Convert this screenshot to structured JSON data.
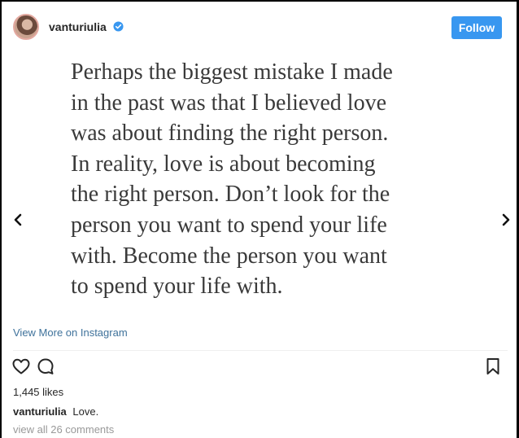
{
  "post": {
    "username": "vanturiulia",
    "verified": true,
    "follow_label": "Follow",
    "quote_lines": [
      "Perhaps the biggest mistake I made",
      "in the past was that I believed love",
      "was about finding the right person.",
      "In reality, love is about becoming",
      "the right person. Don’t look for the",
      "person you want to spend your life",
      "with. Become the person you want",
      "to spend your life with."
    ],
    "view_more_label": "View More on Instagram",
    "likes": "1,445 likes",
    "caption_user": "vanturiulia",
    "caption_text": "Love.",
    "comments_link": "view all 26 comments"
  },
  "icons": {
    "verified": "verified-badge-icon",
    "prev": "chevron-left-icon",
    "next": "chevron-right-icon",
    "like": "heart-icon",
    "comment": "comment-bubble-icon",
    "save": "bookmark-icon"
  },
  "colors": {
    "follow_button": "#3897f0",
    "link": "#3f729b",
    "verified": "#3897f0",
    "muted": "#999999"
  }
}
